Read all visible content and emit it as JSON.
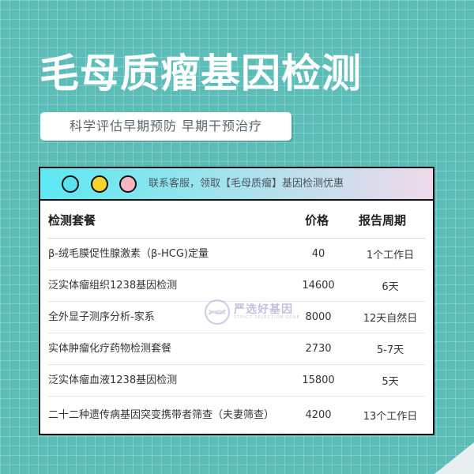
{
  "header": {
    "title": "毛母质瘤基因检测",
    "subtitle": "科学评估早期预防 早期干预治疗"
  },
  "panel": {
    "notice": "联系客服，领取【毛母质瘤】基因检测优惠",
    "columns": [
      "检测套餐",
      "价格",
      "报告周期"
    ],
    "rows": [
      [
        "β-绒毛膜促性腺激素（β-HCG)定量",
        "40",
        "1个工作日"
      ],
      [
        "泛实体瘤组织1238基因检测",
        "14600",
        "6天"
      ],
      [
        "全外显子测序分析-家系",
        "8000",
        "12天自然日"
      ],
      [
        "实体肿瘤化疗药物检测套餐",
        "2730",
        "5-7天"
      ],
      [
        "泛实体瘤血液1238基因检测",
        "15800",
        "5天"
      ],
      [
        "二十二种遗传病基因突变携带者筛查（夫妻筛查）",
        "4200",
        "13个工作日"
      ]
    ]
  },
  "watermark": {
    "text": "严选好基因",
    "sub": "STRICT SELECTION GENE"
  },
  "colors": {
    "background": "#5bbcb8",
    "dot_cyan": "#59e2ee",
    "dot_yellow": "#f6d22d",
    "dot_pink": "#f7b6bf"
  }
}
